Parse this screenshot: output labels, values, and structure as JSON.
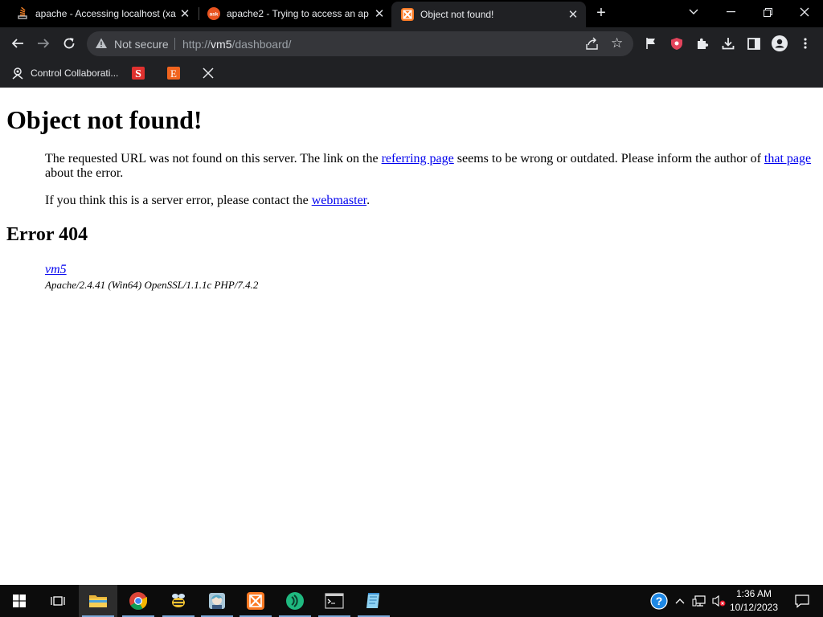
{
  "browser": {
    "tabs": [
      {
        "title": "apache - Accessing localhost (xa",
        "favicon": "stack-overflow-icon",
        "active": false
      },
      {
        "title": "apache2 - Trying to access an ap",
        "favicon": "ask-ubuntu-icon",
        "active": false
      },
      {
        "title": "Object not found!",
        "favicon": "xampp-icon",
        "active": true
      }
    ],
    "toolbar": {
      "security_label": "Not secure",
      "url_scheme": "http://",
      "url_host": "vm5",
      "url_path": "/dashboard/"
    },
    "bookmarks": [
      {
        "label": "Control Collaborati...",
        "icon": "control-collaboration-icon"
      },
      {
        "label": "",
        "icon": "s-bookmark-icon"
      },
      {
        "label": "",
        "icon": "e-bookmark-icon"
      },
      {
        "label": "",
        "icon": "x-bookmark-icon"
      }
    ]
  },
  "page": {
    "heading": "Object not found!",
    "para1_before": "The requested URL was not found on this server. The link on the ",
    "para1_link1": "referring page",
    "para1_middle": " seems to be wrong or outdated. Please inform the author of ",
    "para1_link2": "that page",
    "para1_after": "about the error.",
    "para2_before": "If you think this is a server error, please contact the ",
    "para2_link": "webmaster",
    "para2_after": ".",
    "error_heading": "Error 404",
    "host_link": "vm5",
    "server_signature": "Apache/2.4.41 (Win64) OpenSSL/1.1.1c PHP/7.4.2"
  },
  "taskbar": {
    "apps": [
      "start-icon",
      "task-view-icon",
      "file-explorer-icon",
      "chrome-icon",
      "bee-app-icon",
      "anime-app-icon",
      "xampp-icon",
      "green-app-icon",
      "terminal-icon",
      "notepad-icon"
    ],
    "clock_time": "1:36 AM",
    "clock_date": "10/12/2023"
  },
  "colors": {
    "chrome_dark": "#202124",
    "tabstrip": "#000000",
    "link": "#0000ee",
    "taskbar": "#0c0c0c"
  }
}
